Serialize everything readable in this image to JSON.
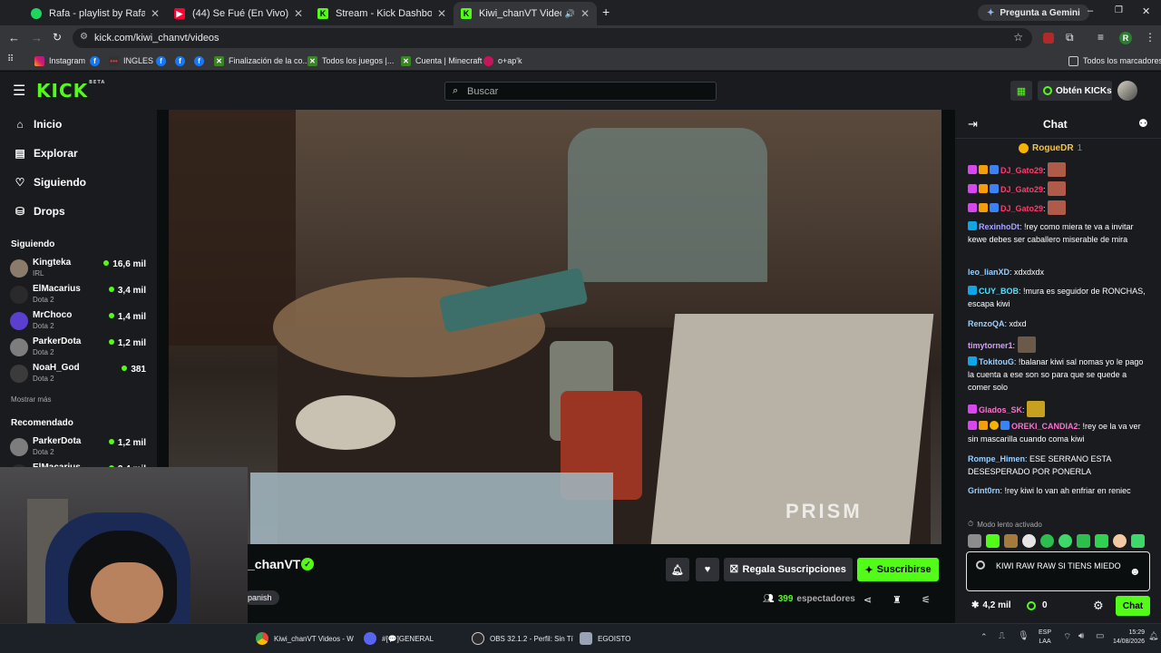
{
  "browser": {
    "tabs": [
      {
        "title": "Rafa - playlist by Rafael.xared |"
      },
      {
        "title": "(44) Se Fué (En Vivo) - YouTube"
      },
      {
        "title": "Stream - Kick Dashboard"
      },
      {
        "title": "Kiwi_chanVT Videos - Watc"
      }
    ],
    "gemini_label": "Pregunta a Gemini",
    "url": "kick.com/kiwi_chanvt/videos",
    "profile_initial": "R",
    "bookmarks": [
      "Instagram",
      "INGLES",
      "Finalización de la co...",
      "Todos los juegos |...",
      "Cuenta | Minecraft",
      "o+ap'k"
    ],
    "all_bookmarks": "Todos los marcadores"
  },
  "kick": {
    "logo": "KICK",
    "logo_tag": "BETA",
    "search_placeholder": "Buscar",
    "get_kicks": "Obtén KICKs",
    "nav": [
      {
        "label": "Inicio",
        "icon": "home-icon"
      },
      {
        "label": "Explorar",
        "icon": "compass-icon"
      },
      {
        "label": "Siguiendo",
        "icon": "heart-icon"
      },
      {
        "label": "Drops",
        "icon": "gift-icon"
      }
    ],
    "following_title": "Siguiendo",
    "following": [
      {
        "name": "Kingteka",
        "category": "IRL",
        "viewers": "16,6 mil"
      },
      {
        "name": "ElMacarius",
        "category": "Dota 2",
        "viewers": "3,4 mil"
      },
      {
        "name": "MrChoco",
        "category": "Dota 2",
        "viewers": "1,4 mil"
      },
      {
        "name": "ParkerDota",
        "category": "Dota 2",
        "viewers": "1,2 mil"
      },
      {
        "name": "NoaH_God",
        "category": "Dota 2",
        "viewers": "381"
      }
    ],
    "show_more": "Mostrar más",
    "recommended_title": "Recomendado",
    "recommended": [
      {
        "name": "ParkerDota",
        "category": "Dota 2",
        "viewers": "1,2 mil"
      },
      {
        "name": "ElMacarius",
        "category": "",
        "viewers": "3,4 mil"
      }
    ],
    "video_watermark": "PRISM",
    "channel_name": "_chanVT",
    "language_tag": "panish",
    "gift_subs": "Regala Suscripciones",
    "subscribe": "Suscribirse",
    "viewers_count": "399",
    "viewers_label": "espectadores"
  },
  "chat": {
    "title": "Chat",
    "pinned_user": "RogueDR",
    "pinned_count": "1",
    "messages": [
      {
        "user": "DJ_Gato29",
        "text": "",
        "color": "#ff3b6b",
        "emote": true
      },
      {
        "user": "DJ_Gato29",
        "text": "",
        "color": "#ff3b6b",
        "emote": true
      },
      {
        "user": "DJ_Gato29",
        "text": "",
        "color": "#ff3b6b",
        "emote": true
      },
      {
        "user": "RexinhoDt",
        "text": "!rey como miera te va a invitar kewe debes ser caballero miserable de mira",
        "color": "#a6a6ff"
      },
      {
        "user": "leo_lianXD",
        "text": "xdxdxdx",
        "color": "#9ad0ff"
      },
      {
        "user": "CUY_BOB",
        "text": "!mura es seguidor de RONCHAS, escapa kiwi",
        "color": "#53e0ff"
      },
      {
        "user": "RenzoQA",
        "text": "xdxd",
        "color": "#9ad0ff"
      },
      {
        "user": "timytorner1",
        "text": "",
        "color": "#d89cff",
        "emote": true
      },
      {
        "user": "TokitouG",
        "text": "!balanar kiwi sal nomas yo le pago la cuenta a ese son so para que se quede a comer solo",
        "color": "#9ad0ff"
      },
      {
        "user": "Glados_SK",
        "text": "",
        "color": "#ff6fd0",
        "emote": true
      },
      {
        "user": "OREKI_CANDIA2",
        "text": "!rey oe la va ver sin mascarilla cuando coma kiwi",
        "color": "#ff6fd0"
      },
      {
        "user": "Rompe_Himen",
        "text": "ESE SERRANO ESTA DESESPERADO POR PONERLA",
        "color": "#9ad0ff"
      },
      {
        "user": "Grint0rn",
        "text": "!rey kiwi lo van ah enfriar en reniec",
        "color": "#9ad0ff"
      }
    ],
    "slow_mode": "Modo lento activado",
    "input_value": "KIWI RAW RAW SI TIENS MIEDO",
    "kicks_count": "4,2 mil",
    "points": "0",
    "send_label": "Chat"
  },
  "taskbar": {
    "items": [
      "Kiwi_chanVT Videos - W",
      "#[💬]GENERAL",
      "OBS 32.1.2 - Perfil: Sin Tí",
      "EGOISTO"
    ],
    "lang_top": "ESP",
    "lang_bottom": "LAA",
    "time": "15:29",
    "date": "14/08/2026"
  },
  "colors": {
    "kick_green": "#53fc18",
    "bg": "#0b0e0f",
    "panel": "#191b1f"
  }
}
